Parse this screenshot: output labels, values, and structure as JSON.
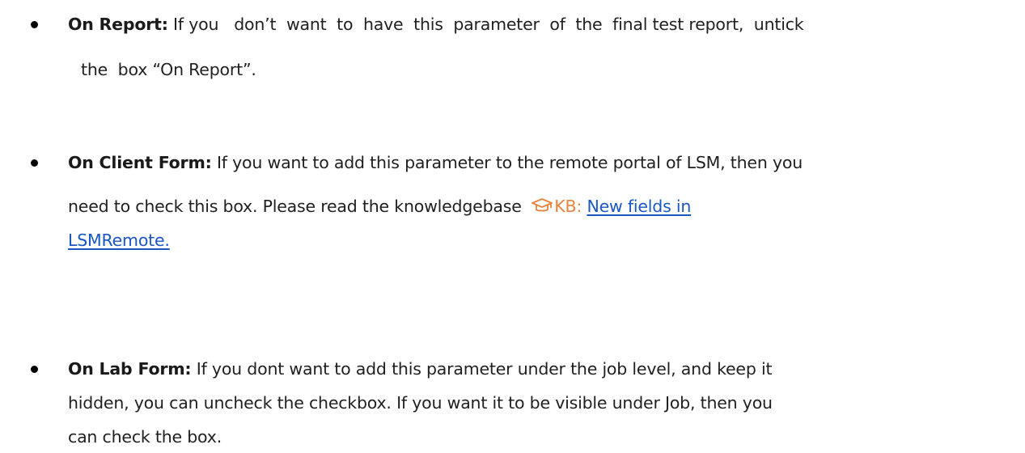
{
  "items": [
    {
      "term": "On Report:",
      "line1": " If you   don’t  want  to  have  this  parameter  of  the  final test report,  untick",
      "line2": "the  box “On Report”."
    },
    {
      "term": "On Client Form:",
      "line1": " If you want to add this parameter to the remote portal of LSM, then you",
      "line2": "need to check this box. Please read the knowledgebase  ",
      "kb_label": "KB:",
      "kb_icon": "graduation-cap-icon",
      "kb_color": "#e8823a",
      "link_part1": "New fields in",
      "link_part2": "LSMRemote."
    },
    {
      "term": "On Lab Form:",
      "line1": " If you dont want to add this parameter under the job level, and keep it",
      "line2": "hidden, you can uncheck the checkbox. If you want it to be visible under Job, then you",
      "line3": "can check the box."
    }
  ]
}
